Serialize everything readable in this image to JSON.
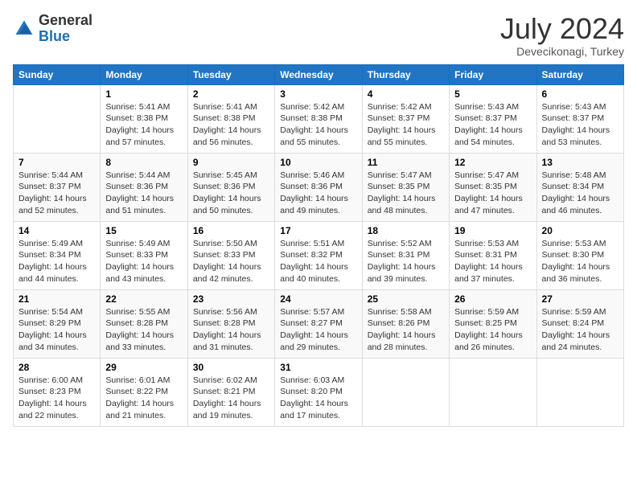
{
  "header": {
    "logo_general": "General",
    "logo_blue": "Blue",
    "month_title": "July 2024",
    "location": "Devecikonagi, Turkey"
  },
  "calendar": {
    "days_of_week": [
      "Sunday",
      "Monday",
      "Tuesday",
      "Wednesday",
      "Thursday",
      "Friday",
      "Saturday"
    ],
    "weeks": [
      [
        {
          "day": "",
          "info": ""
        },
        {
          "day": "1",
          "info": "Sunrise: 5:41 AM\nSunset: 8:38 PM\nDaylight: 14 hours\nand 57 minutes."
        },
        {
          "day": "2",
          "info": "Sunrise: 5:41 AM\nSunset: 8:38 PM\nDaylight: 14 hours\nand 56 minutes."
        },
        {
          "day": "3",
          "info": "Sunrise: 5:42 AM\nSunset: 8:38 PM\nDaylight: 14 hours\nand 55 minutes."
        },
        {
          "day": "4",
          "info": "Sunrise: 5:42 AM\nSunset: 8:37 PM\nDaylight: 14 hours\nand 55 minutes."
        },
        {
          "day": "5",
          "info": "Sunrise: 5:43 AM\nSunset: 8:37 PM\nDaylight: 14 hours\nand 54 minutes."
        },
        {
          "day": "6",
          "info": "Sunrise: 5:43 AM\nSunset: 8:37 PM\nDaylight: 14 hours\nand 53 minutes."
        }
      ],
      [
        {
          "day": "7",
          "info": "Sunrise: 5:44 AM\nSunset: 8:37 PM\nDaylight: 14 hours\nand 52 minutes."
        },
        {
          "day": "8",
          "info": "Sunrise: 5:44 AM\nSunset: 8:36 PM\nDaylight: 14 hours\nand 51 minutes."
        },
        {
          "day": "9",
          "info": "Sunrise: 5:45 AM\nSunset: 8:36 PM\nDaylight: 14 hours\nand 50 minutes."
        },
        {
          "day": "10",
          "info": "Sunrise: 5:46 AM\nSunset: 8:36 PM\nDaylight: 14 hours\nand 49 minutes."
        },
        {
          "day": "11",
          "info": "Sunrise: 5:47 AM\nSunset: 8:35 PM\nDaylight: 14 hours\nand 48 minutes."
        },
        {
          "day": "12",
          "info": "Sunrise: 5:47 AM\nSunset: 8:35 PM\nDaylight: 14 hours\nand 47 minutes."
        },
        {
          "day": "13",
          "info": "Sunrise: 5:48 AM\nSunset: 8:34 PM\nDaylight: 14 hours\nand 46 minutes."
        }
      ],
      [
        {
          "day": "14",
          "info": "Sunrise: 5:49 AM\nSunset: 8:34 PM\nDaylight: 14 hours\nand 44 minutes."
        },
        {
          "day": "15",
          "info": "Sunrise: 5:49 AM\nSunset: 8:33 PM\nDaylight: 14 hours\nand 43 minutes."
        },
        {
          "day": "16",
          "info": "Sunrise: 5:50 AM\nSunset: 8:33 PM\nDaylight: 14 hours\nand 42 minutes."
        },
        {
          "day": "17",
          "info": "Sunrise: 5:51 AM\nSunset: 8:32 PM\nDaylight: 14 hours\nand 40 minutes."
        },
        {
          "day": "18",
          "info": "Sunrise: 5:52 AM\nSunset: 8:31 PM\nDaylight: 14 hours\nand 39 minutes."
        },
        {
          "day": "19",
          "info": "Sunrise: 5:53 AM\nSunset: 8:31 PM\nDaylight: 14 hours\nand 37 minutes."
        },
        {
          "day": "20",
          "info": "Sunrise: 5:53 AM\nSunset: 8:30 PM\nDaylight: 14 hours\nand 36 minutes."
        }
      ],
      [
        {
          "day": "21",
          "info": "Sunrise: 5:54 AM\nSunset: 8:29 PM\nDaylight: 14 hours\nand 34 minutes."
        },
        {
          "day": "22",
          "info": "Sunrise: 5:55 AM\nSunset: 8:28 PM\nDaylight: 14 hours\nand 33 minutes."
        },
        {
          "day": "23",
          "info": "Sunrise: 5:56 AM\nSunset: 8:28 PM\nDaylight: 14 hours\nand 31 minutes."
        },
        {
          "day": "24",
          "info": "Sunrise: 5:57 AM\nSunset: 8:27 PM\nDaylight: 14 hours\nand 29 minutes."
        },
        {
          "day": "25",
          "info": "Sunrise: 5:58 AM\nSunset: 8:26 PM\nDaylight: 14 hours\nand 28 minutes."
        },
        {
          "day": "26",
          "info": "Sunrise: 5:59 AM\nSunset: 8:25 PM\nDaylight: 14 hours\nand 26 minutes."
        },
        {
          "day": "27",
          "info": "Sunrise: 5:59 AM\nSunset: 8:24 PM\nDaylight: 14 hours\nand 24 minutes."
        }
      ],
      [
        {
          "day": "28",
          "info": "Sunrise: 6:00 AM\nSunset: 8:23 PM\nDaylight: 14 hours\nand 22 minutes."
        },
        {
          "day": "29",
          "info": "Sunrise: 6:01 AM\nSunset: 8:22 PM\nDaylight: 14 hours\nand 21 minutes."
        },
        {
          "day": "30",
          "info": "Sunrise: 6:02 AM\nSunset: 8:21 PM\nDaylight: 14 hours\nand 19 minutes."
        },
        {
          "day": "31",
          "info": "Sunrise: 6:03 AM\nSunset: 8:20 PM\nDaylight: 14 hours\nand 17 minutes."
        },
        {
          "day": "",
          "info": ""
        },
        {
          "day": "",
          "info": ""
        },
        {
          "day": "",
          "info": ""
        }
      ]
    ]
  }
}
